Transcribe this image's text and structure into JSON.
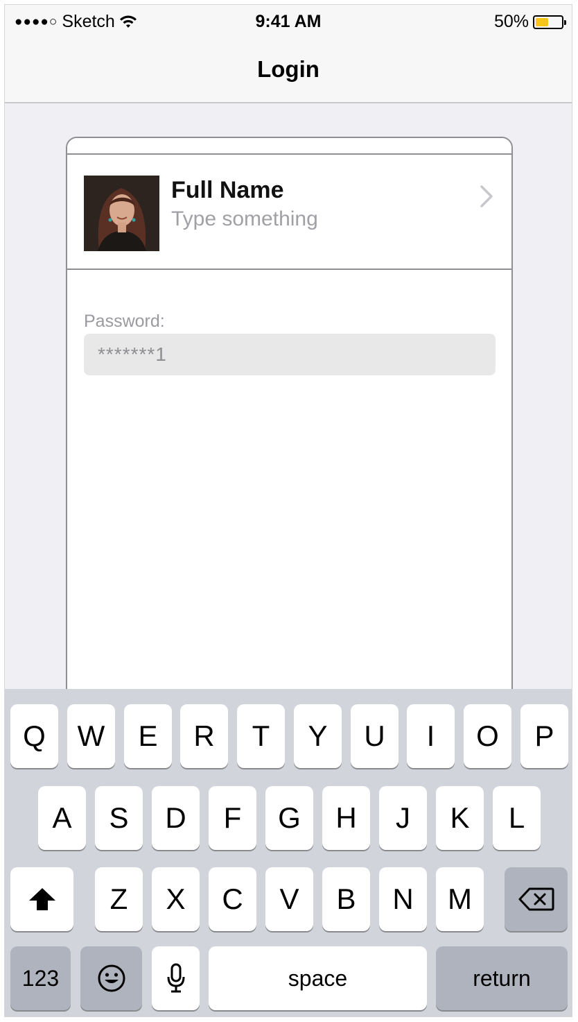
{
  "status_bar": {
    "signal": "●●●●○",
    "carrier": "Sketch",
    "time": "9:41 AM",
    "battery_percent": "50%",
    "battery_level": 0.5,
    "battery_color": "#f5c518"
  },
  "nav": {
    "title": "Login"
  },
  "profile": {
    "name": "Full Name",
    "subtitle": "Type something",
    "chevron_icon": "chevron-right-icon"
  },
  "password": {
    "label": "Password:",
    "value": "*******1"
  },
  "keyboard": {
    "row1": [
      "Q",
      "W",
      "E",
      "R",
      "T",
      "Y",
      "U",
      "I",
      "O",
      "P"
    ],
    "row2": [
      "A",
      "S",
      "D",
      "F",
      "G",
      "H",
      "J",
      "K",
      "L"
    ],
    "row3": [
      "Z",
      "X",
      "C",
      "V",
      "B",
      "N",
      "M"
    ],
    "shift_icon": "shift-arrow-icon",
    "backspace_icon": "backspace-icon",
    "numbers_label": "123",
    "emoji_icon": "emoji-icon",
    "mic_icon": "microphone-icon",
    "space_label": "space",
    "return_label": "return"
  }
}
